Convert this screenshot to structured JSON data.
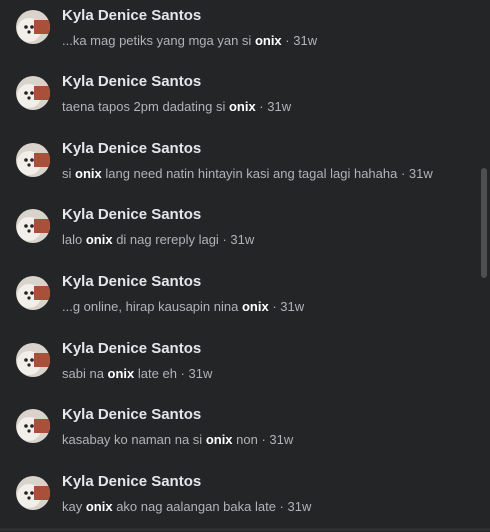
{
  "results": [
    {
      "name": "Kyla Denice Santos",
      "before": "...ka mag petiks yang mga yan si ",
      "keyword": "onix",
      "after": "",
      "time": "31w"
    },
    {
      "name": "Kyla Denice Santos",
      "before": "taena tapos 2pm dadating si ",
      "keyword": "onix",
      "after": "",
      "time": "31w"
    },
    {
      "name": "Kyla Denice Santos",
      "before": "si ",
      "keyword": "onix",
      "after": " lang need natin hintayin kasi ang tagal lagi hahaha",
      "time": "31w"
    },
    {
      "name": "Kyla Denice Santos",
      "before": "lalo ",
      "keyword": "onix",
      "after": " di nag rereply lagi",
      "time": "31w"
    },
    {
      "name": "Kyla Denice Santos",
      "before": "...g online, hirap kausapin nina ",
      "keyword": "onix",
      "after": "",
      "time": "31w"
    },
    {
      "name": "Kyla Denice Santos",
      "before": "sabi na ",
      "keyword": "onix",
      "after": " late eh",
      "time": "31w"
    },
    {
      "name": "Kyla Denice Santos",
      "before": "kasabay ko naman na si ",
      "keyword": "onix",
      "after": " non",
      "time": "31w"
    },
    {
      "name": "Kyla Denice Santos",
      "before": "kay ",
      "keyword": "onix",
      "after": " ako nag aalangan baka late",
      "time": "31w"
    }
  ],
  "separator": " · ",
  "colors": {
    "background": "#242526",
    "name_text": "#e4e6eb",
    "snippet_text": "#b0b3b8",
    "keyword_text": "#ffffff",
    "scroll_thumb": "#4e4f50"
  },
  "icons": {
    "avatar": "profile-photo-dog-icon"
  }
}
